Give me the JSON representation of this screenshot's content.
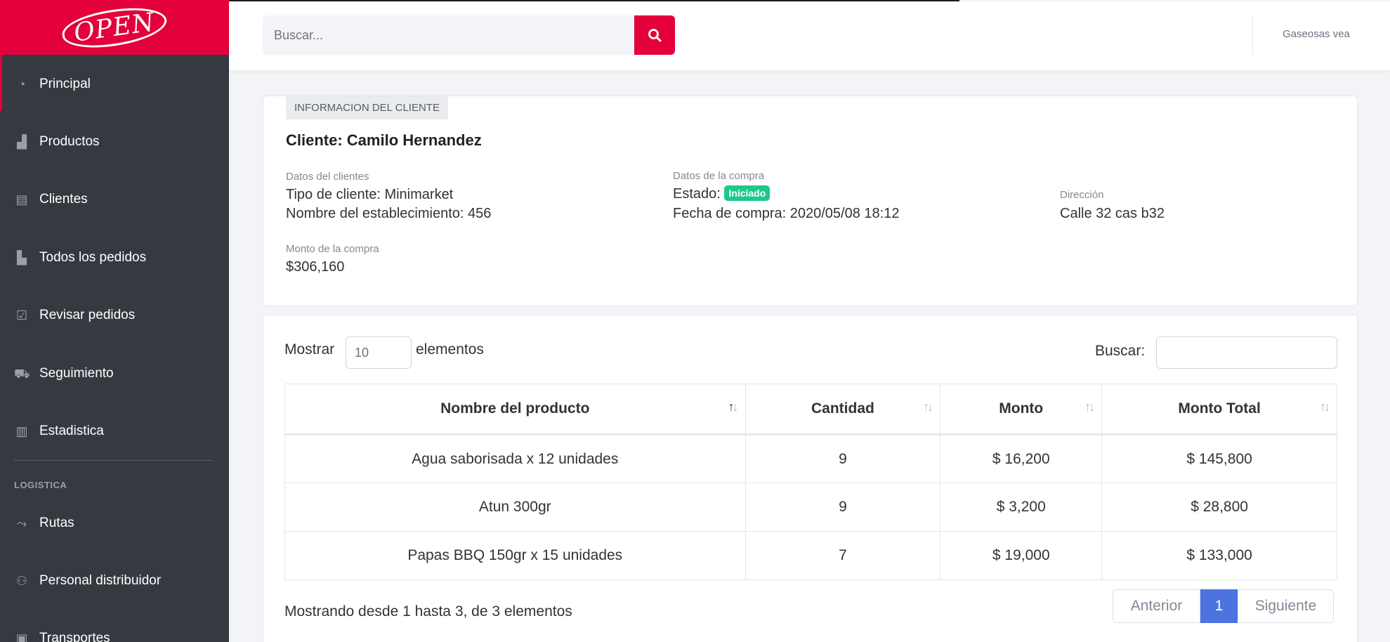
{
  "brand": {
    "logo_text": "OPEN"
  },
  "sidebar": {
    "items": [
      {
        "label": "Principal",
        "icon": "tachometer-icon"
      },
      {
        "label": "Productos",
        "icon": "boxes-icon"
      },
      {
        "label": "Clientes",
        "icon": "store-icon"
      },
      {
        "label": "Todos los pedidos",
        "icon": "pallet-icon"
      },
      {
        "label": "Revisar pedidos",
        "icon": "check-square-icon"
      },
      {
        "label": "Seguimiento",
        "icon": "truck-icon"
      },
      {
        "label": "Estadistica",
        "icon": "chart-bar-icon"
      },
      {
        "label": "Rutas",
        "icon": "route-icon"
      },
      {
        "label": "Personal distribuidor",
        "icon": "users-icon"
      },
      {
        "label": "Transportes",
        "icon": "bus-icon"
      }
    ],
    "section_logistica": "LOGISTICA"
  },
  "topbar": {
    "search_placeholder": "Buscar...",
    "user_name": "Gaseosas vea"
  },
  "client": {
    "tag": "INFORMACION DEL CLIENTE",
    "name": "Cliente: Camilo Hernandez",
    "datos_label": "Datos del clientes",
    "tipo": "Tipo de cliente: Minimarket",
    "establecimiento": "Nombre del establecimiento: 456",
    "compra_label": "Datos de la compra",
    "estado_prefix": "Estado:",
    "estado_badge": "Iniciado",
    "fecha": "Fecha de compra: 2020/05/08 18:12",
    "direccion_label": "Dirección",
    "direccion": "Calle 32 cas b32",
    "monto_label": "Monto de la compra",
    "monto": "$306,160"
  },
  "table": {
    "show_label": "Mostrar",
    "show_value": "10",
    "show_suffix": "elementos",
    "filter_label": "Buscar:",
    "headers": [
      "Nombre del producto",
      "Cantidad",
      "Monto",
      "Monto Total"
    ],
    "rows": [
      [
        "Agua saborisada x 12 unidades",
        "9",
        "$ 16,200",
        "$ 145,800"
      ],
      [
        "Atun 300gr",
        "9",
        "$ 3,200",
        "$ 28,800"
      ],
      [
        "Papas BBQ 150gr x 15 unidades",
        "7",
        "$ 19,000",
        "$ 133,000"
      ]
    ],
    "info": "Mostrando desde 1 hasta 3, de 3 elementos",
    "prev": "Anterior",
    "page": "1",
    "next": "Siguiente"
  },
  "colors": {
    "brand": "#e4003a",
    "sidebar": "#343a40",
    "badge": "#1cc88a",
    "page_active": "#4e73df"
  }
}
